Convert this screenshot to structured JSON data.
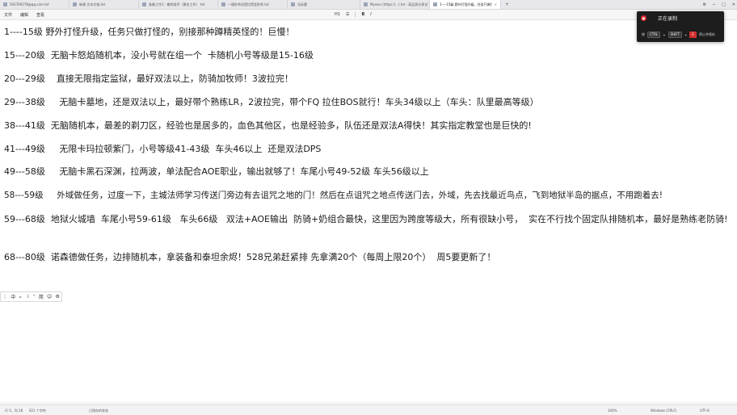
{
  "tabs": [
    {
      "label": "592760278@qq.com.txt",
      "active": false
    },
    {
      "label": "新建 文本文档.txt",
      "active": false
    },
    {
      "label": "准备工作1：搬砖组件（黄金工作）.txt",
      "active": false
    },
    {
      "label": "一键秒杀但是拉黑会秒杀.txt",
      "active": false
    },
    {
      "label": "无标题",
      "active": false
    },
    {
      "label": "Mysion (https://...).txt - 高品质分享试",
      "active": false
    },
    {
      "label": "1----15级 野外打怪升级，任务只做打怪的",
      "active": true
    }
  ],
  "menu": [
    "文件",
    "编辑",
    "查看"
  ],
  "format_toolbar": {
    "heading": "H1",
    "list": "☰",
    "bold": "B",
    "italic": "I"
  },
  "recording": {
    "title": "正在录制",
    "hotkey_prefix": "按",
    "keys": [
      "CTRL",
      "SHIFT",
      "E"
    ],
    "hint": "停止并保存"
  },
  "lines": [
    "1----15级 野外打怪升级，任务只做打怪的，别接那种蹲精英怪的！巨慢！",
    "15---20级  无脑卡怒焰随机本，没小号就在组一个  卡随机小号等级是15-16级",
    "20---29级    直接无限指定监狱，最好双法以上，防骑加牧师！3波拉完！",
    "29---38级     无脑卡墓地，还是双法以上，最好带个熟练LR，2波拉完，带个FQ 拉住BOS就行！车头34级以上（车头：队里最高等级）",
    "38---41级  无脑随机本，最差的剃刀区，经验也是居多的，血色其他区，也是经验多，队伍还是双法A得快！其实指定教堂也是巨快的!",
    "41---49级     无限卡玛拉顿紫门，小号等级41-43级  车头46以上  还是双法DPS",
    "49---58级     无脑卡黑石深渊，拉两波，单法配合AOE职业，输出就够了！车尾小号49-52级 车头56级以上",
    "58---59级     外域做任务，过度一下，主城法师学习传送门旁边有去诅咒之地的门！然后在点诅咒之地点传送门去，外域，先去找最近鸟点，飞到地狱半岛的据点，不用跑着去!",
    "59---68级  地狱火城墙  车尾小号59-61级   车头66级   双法+AOE输出  防骑+奶组合最快，这里因为跨度等级大，所有很缺小号，  实在不行找个固定队排随机本，最好是熟练老防骑!",
    "68---80级  诺森德做任务，边排随机本，拿装备和泰坦余烬！528兄弟赶紧排 先拿满20个（每周上限20个）  周5要更新了！"
  ],
  "ime": {
    "lang": "中",
    "items": [
      "中",
      "⸰",
      "☽",
      "⁺",
      "简",
      "☺",
      "⚙"
    ]
  },
  "status": {
    "cursor": "行 5，列 18",
    "chars": "621 个字符",
    "autosave": "已保存的状态",
    "zoom": "100%",
    "eol": "Windows (CRLF)",
    "encoding": "UTF-8"
  }
}
